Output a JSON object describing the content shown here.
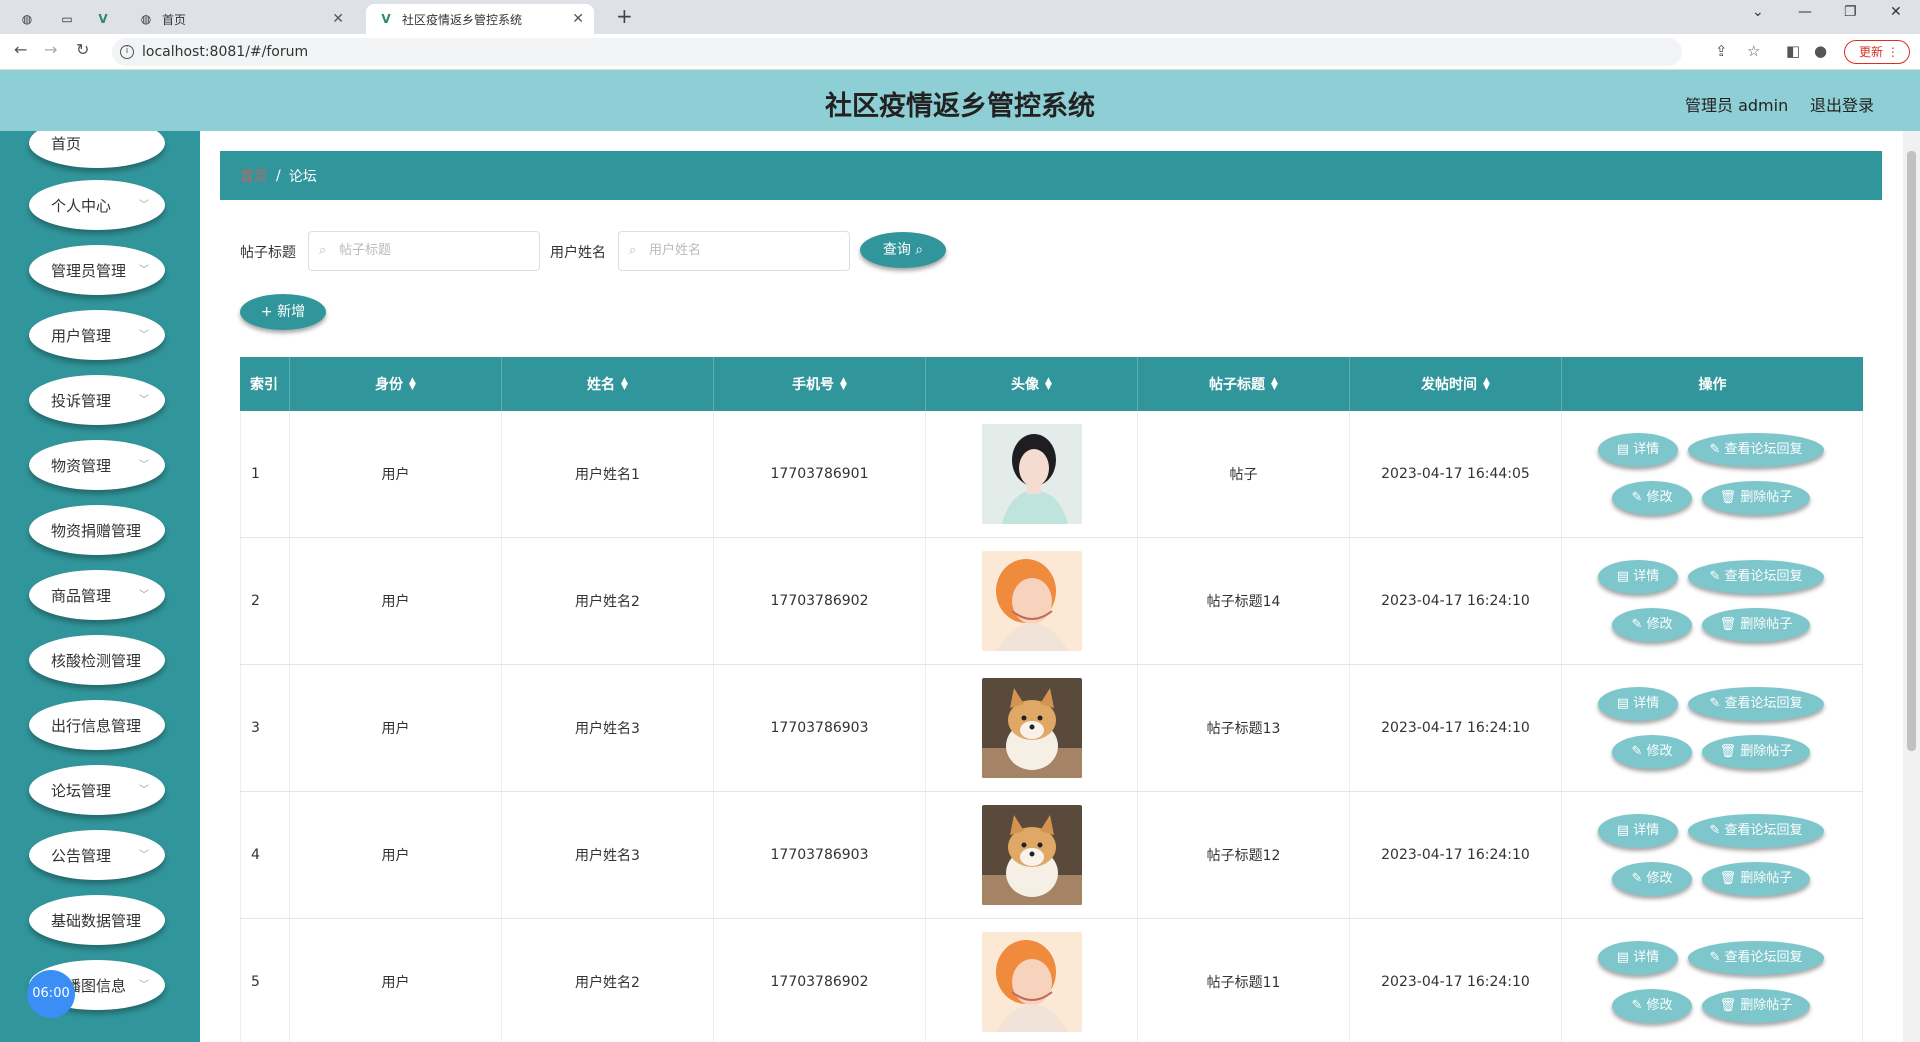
{
  "browser": {
    "tabs": [
      {
        "title": "首页"
      },
      {
        "title": "社区疫情返乡管控系统"
      }
    ],
    "url": "localhost:8081/#/forum",
    "update_label": "更新"
  },
  "header": {
    "title": "社区疫情返乡管控系统",
    "user": "管理员 admin",
    "logout": "退出登录"
  },
  "sidebar": {
    "items": [
      {
        "label": "首页"
      },
      {
        "label": "个人中心"
      },
      {
        "label": "管理员管理"
      },
      {
        "label": "用户管理"
      },
      {
        "label": "投诉管理"
      },
      {
        "label": "物资管理"
      },
      {
        "label": "物资捐赠管理"
      },
      {
        "label": "商品管理"
      },
      {
        "label": "核酸检测管理"
      },
      {
        "label": "出行信息管理"
      },
      {
        "label": "论坛管理"
      },
      {
        "label": "公告管理"
      },
      {
        "label": "基础数据管理"
      },
      {
        "label": "轮播图信息"
      }
    ],
    "clock": "06:00"
  },
  "breadcrumb": {
    "home": "首页",
    "current": "论坛"
  },
  "search": {
    "title_label": "帖子标题",
    "title_placeholder": "帖子标题",
    "user_label": "用户姓名",
    "user_placeholder": "用户姓名",
    "query_button": "查询",
    "add_button": "新增"
  },
  "table": {
    "headers": [
      "索引",
      "身份",
      "姓名",
      "手机号",
      "头像",
      "帖子标题",
      "发帖时间",
      "操作"
    ],
    "rows": [
      {
        "index": "1",
        "role": "用户",
        "name": "用户姓名1",
        "phone": "17703786901",
        "avatar": "woman-portrait",
        "title": "帖子",
        "time": "2023-04-17 16:44:05"
      },
      {
        "index": "2",
        "role": "用户",
        "name": "用户姓名2",
        "phone": "17703786902",
        "avatar": "girl-smiling",
        "title": "帖子标题14",
        "time": "2023-04-17 16:24:10"
      },
      {
        "index": "3",
        "role": "用户",
        "name": "用户姓名3",
        "phone": "17703786903",
        "avatar": "shiba-dog",
        "title": "帖子标题13",
        "time": "2023-04-17 16:24:10"
      },
      {
        "index": "4",
        "role": "用户",
        "name": "用户姓名3",
        "phone": "17703786903",
        "avatar": "shiba-dog",
        "title": "帖子标题12",
        "time": "2023-04-17 16:24:10"
      },
      {
        "index": "5",
        "role": "用户",
        "name": "用户姓名2",
        "phone": "17703786902",
        "avatar": "girl-smiling",
        "title": "帖子标题11",
        "time": "2023-04-17 16:24:10"
      }
    ],
    "actions": {
      "detail": "详情",
      "replies": "查看论坛回复",
      "edit": "修改",
      "delete": "删除帖子"
    }
  },
  "colors": {
    "primary": "#31969b",
    "header_bg": "#8ecfd6",
    "action_btn": "#7dc6cc"
  }
}
